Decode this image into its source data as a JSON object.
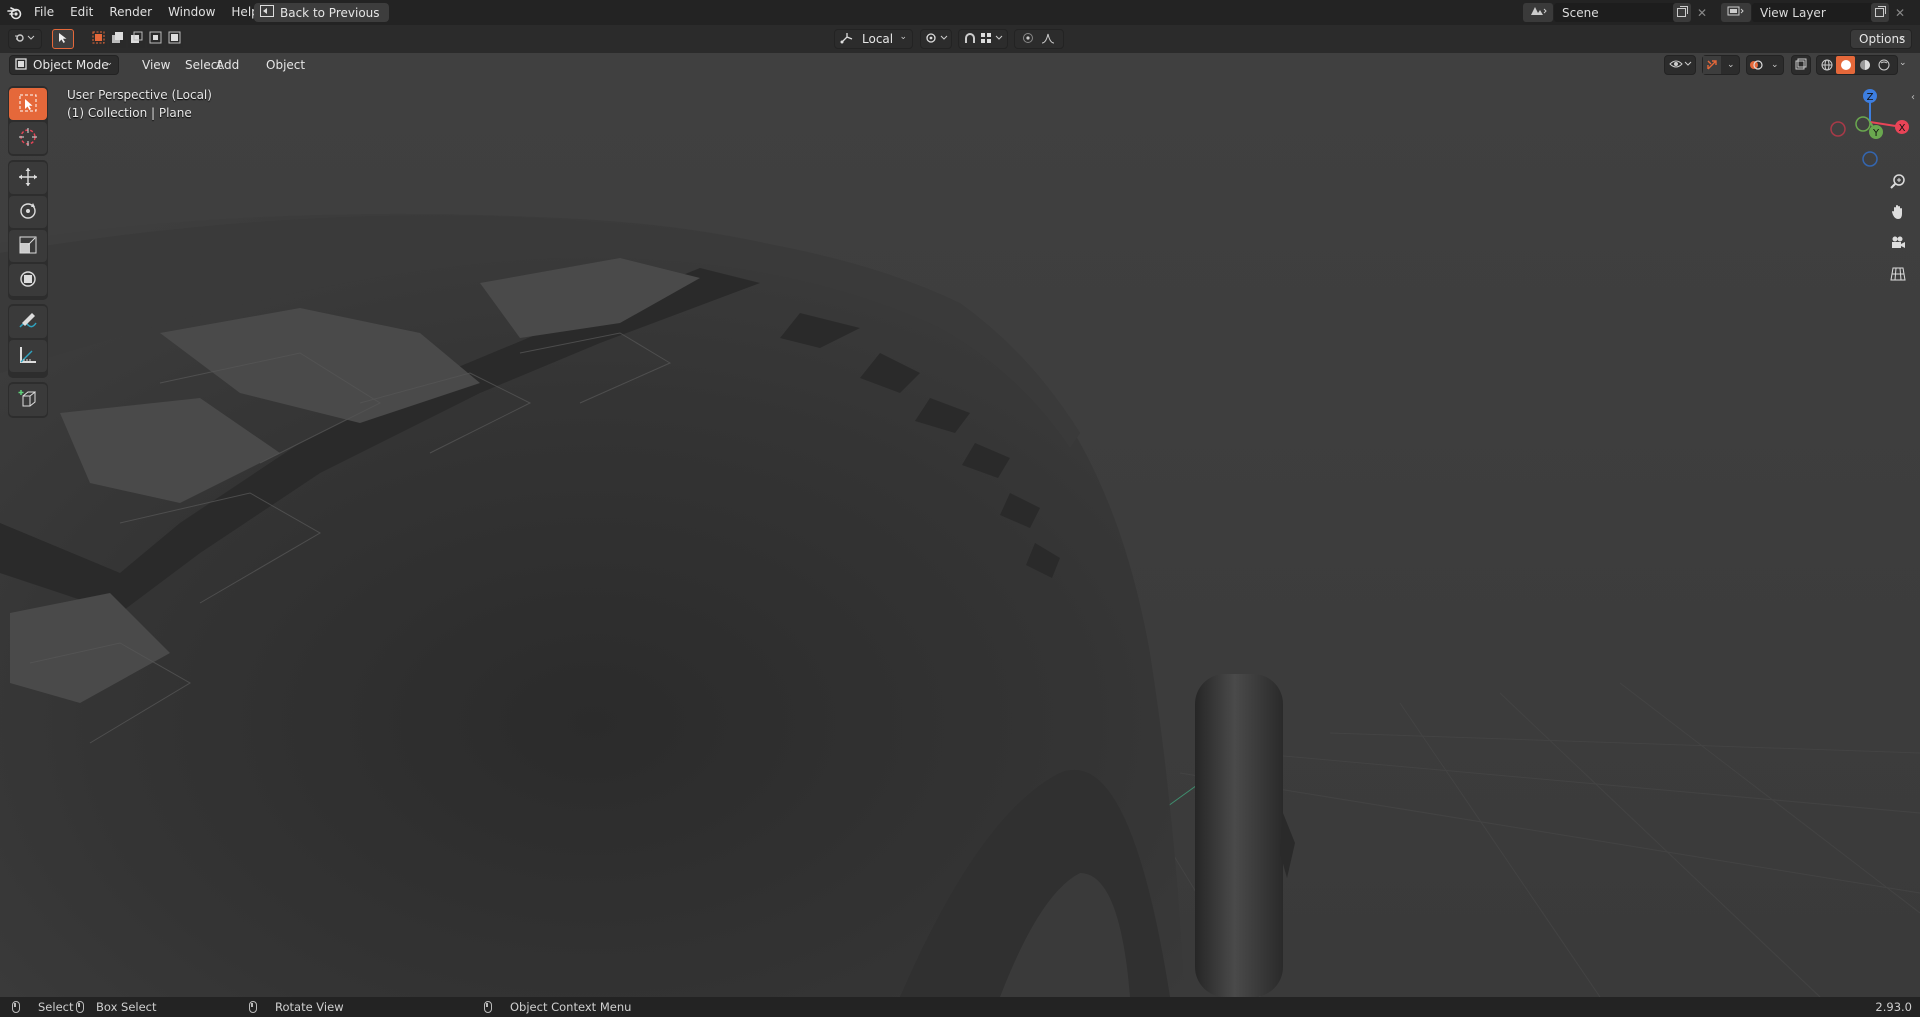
{
  "menu": {
    "items": [
      "File",
      "Edit",
      "Render",
      "Window",
      "Help"
    ],
    "back_button": "Back to Previous"
  },
  "scene": {
    "label": "Scene"
  },
  "view_layer": {
    "label": "View Layer"
  },
  "tool_settings": {
    "transform_orientation": "Local",
    "options_label": "Options"
  },
  "viewport_header": {
    "mode": "Object Mode",
    "menus": [
      "View",
      "Select",
      "Add",
      "Object"
    ]
  },
  "viewport_overlay": {
    "line1": "User Perspective (Local)",
    "line2": "(1) Collection | Plane"
  },
  "gizmo": {
    "z": "Z",
    "y": "Y",
    "x": "X"
  },
  "status": {
    "select": "Select",
    "box_select": "Box Select",
    "rotate_view": "Rotate View",
    "context_menu": "Object Context Menu",
    "version": "2.93.0"
  },
  "colors": {
    "accent": "#e5683a",
    "axis_x": "#e84457",
    "axis_y": "#6aa84f",
    "axis_z": "#3d7ee0"
  }
}
